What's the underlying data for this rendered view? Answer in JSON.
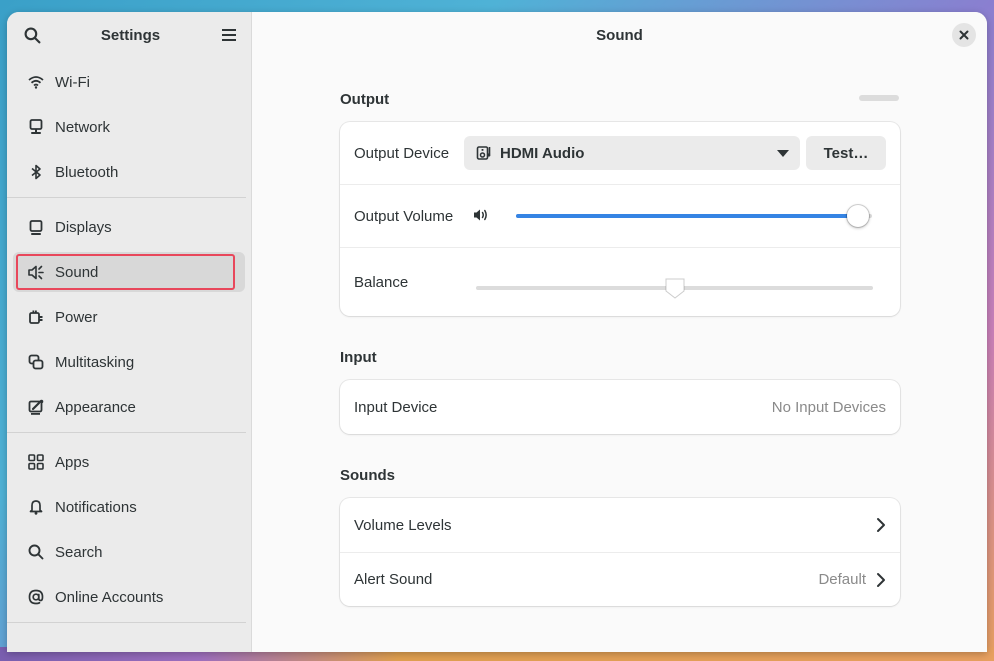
{
  "sidebar": {
    "title": "Settings",
    "search_icon": "search-icon",
    "menu_icon": "hamburger-menu-icon",
    "groups": [
      [
        {
          "label": "Wi-Fi",
          "icon": "wifi-icon"
        },
        {
          "label": "Network",
          "icon": "network-icon"
        },
        {
          "label": "Bluetooth",
          "icon": "bluetooth-icon"
        }
      ],
      [
        {
          "label": "Displays",
          "icon": "display-icon"
        },
        {
          "label": "Sound",
          "icon": "speaker-icon",
          "active": true
        },
        {
          "label": "Power",
          "icon": "power-icon"
        },
        {
          "label": "Multitasking",
          "icon": "multitasking-icon"
        },
        {
          "label": "Appearance",
          "icon": "appearance-icon"
        }
      ],
      [
        {
          "label": "Apps",
          "icon": "apps-grid-icon"
        },
        {
          "label": "Notifications",
          "icon": "bell-icon"
        },
        {
          "label": "Search",
          "icon": "search-icon"
        },
        {
          "label": "Online Accounts",
          "icon": "at-sign-icon"
        }
      ]
    ]
  },
  "main": {
    "title": "Sound",
    "close_icon": "close-icon",
    "output": {
      "heading": "Output",
      "device_label": "Output Device",
      "device_value": "HDMI Audio",
      "test_label": "Test…",
      "volume_label": "Output Volume",
      "volume_level": 0.99,
      "balance_label": "Balance",
      "balance_level": 0.5
    },
    "input": {
      "heading": "Input",
      "device_label": "Input Device",
      "device_value": "No Input Devices"
    },
    "sounds": {
      "heading": "Sounds",
      "volume_levels_label": "Volume Levels",
      "alert_sound_label": "Alert Sound",
      "alert_sound_value": "Default"
    }
  },
  "colors": {
    "accent": "#3584e4",
    "highlight_border": "#e8475b"
  }
}
